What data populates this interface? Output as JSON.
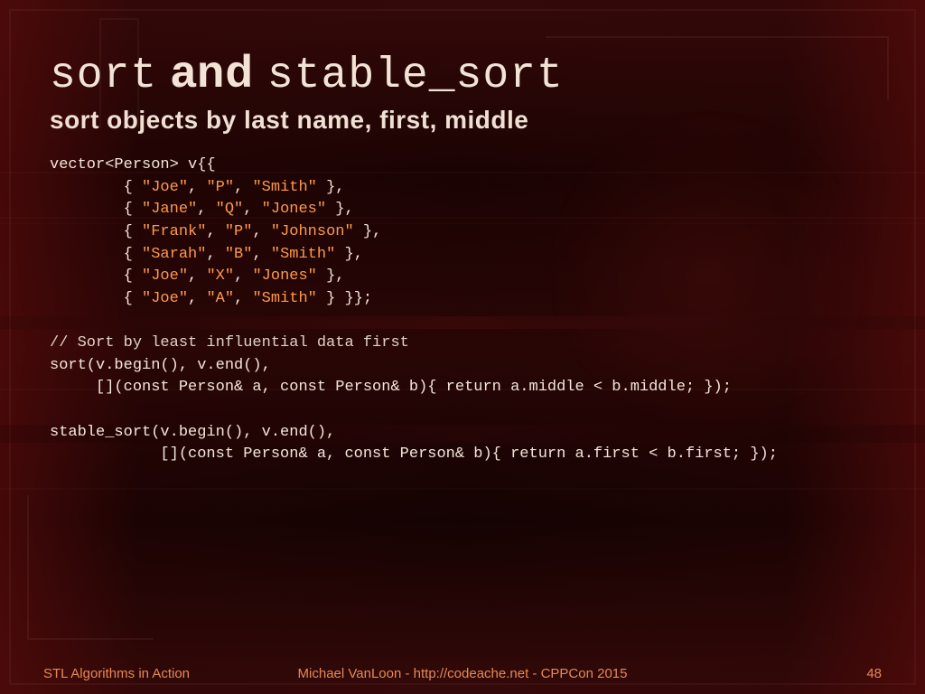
{
  "title": {
    "part1_mono": "sort",
    "part2_and": " and ",
    "part3_mono": "stable_sort"
  },
  "subtitle": "sort objects by last name, first, middle",
  "code": {
    "decl_open": "vector<Person> v{{",
    "people": [
      {
        "first": "\"Joe\"",
        "middle": "\"P\"",
        "last": "\"Smith\""
      },
      {
        "first": "\"Jane\"",
        "middle": "\"Q\"",
        "last": "\"Jones\""
      },
      {
        "first": "\"Frank\"",
        "middle": "\"P\"",
        "last": "\"Johnson\""
      },
      {
        "first": "\"Sarah\"",
        "middle": "\"B\"",
        "last": "\"Smith\""
      },
      {
        "first": "\"Joe\"",
        "middle": "\"X\"",
        "last": "\"Jones\""
      },
      {
        "first": "\"Joe\"",
        "middle": "\"A\"",
        "last": "\"Smith\""
      }
    ],
    "decl_close_suffix": " }};",
    "comment": "// Sort by least influential data first",
    "sort_line1": "sort(v.begin(), v.end(),",
    "sort_line2": "     [](const Person& a, const Person& b){ return a.middle < b.middle; });",
    "stable_line1": "stable_sort(v.begin(), v.end(),",
    "stable_line2": "            [](const Person& a, const Person& b){ return a.first < b.first; });"
  },
  "footer": {
    "left": "STL Algorithms in Action",
    "center": "Michael VanLoon - http://codeache.net - CPPCon 2015",
    "right": "48"
  }
}
